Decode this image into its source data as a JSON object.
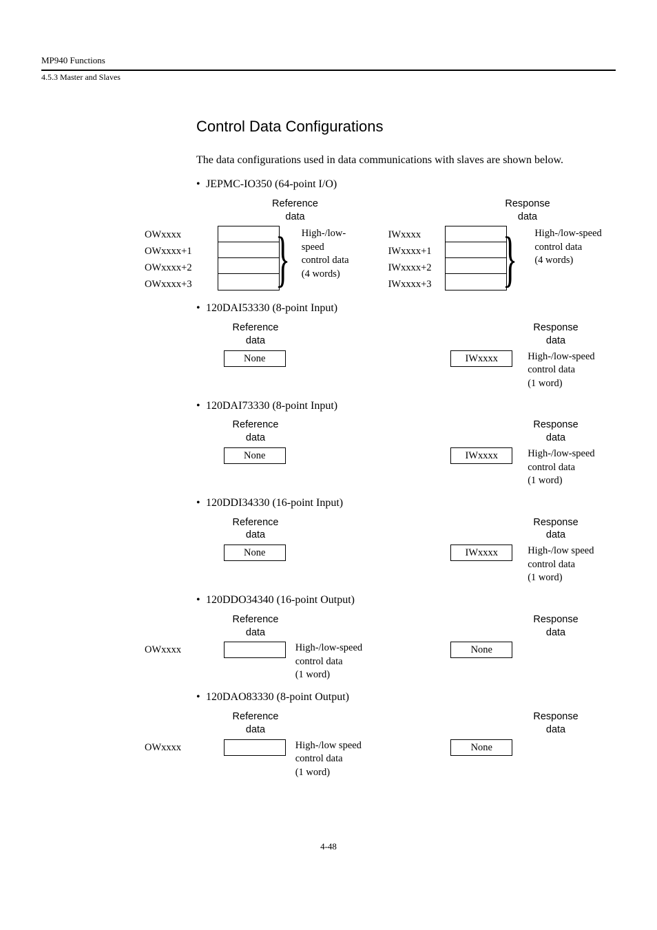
{
  "header": {
    "title": "MP940 Functions",
    "sub": "4.5.3  Master and Slaves"
  },
  "section": {
    "title": "Control Data Configurations",
    "intro": "The data configurations used in data communications with slaves are shown below."
  },
  "bullets": {
    "b1": "JEPMC-IO350 (64-point I/O)",
    "b2": "120DAI53330 (8-point Input)",
    "b3": "120DAI73330 (8-point Input)",
    "b4": "120DDI34330 (16-point Input)",
    "b5": "120DDO34340 (16-point Output)",
    "b6": "120DAO83330 (8-point Output)"
  },
  "labels": {
    "ref": "Reference",
    "resp": "Response",
    "data": "data",
    "none": "None",
    "ow0": "OWxxxx",
    "ow1": "OWxxxx+1",
    "ow2": "OWxxxx+2",
    "ow3": "OWxxxx+3",
    "iw0": "IWxxxx",
    "iw1": "IWxxxx+1",
    "iw2": "IWxxxx+2",
    "iw3": "IWxxxx+3"
  },
  "notes": {
    "hl4_a": "High-/low-",
    "hl4_b": "speed",
    "hl4_c": "control data",
    "hl4_d": "(4 words)",
    "hls4_a": "High-/low-speed",
    "hls4_b": "control data",
    "hls4_c": "(4 words)",
    "hls1_a": "High-/low-speed",
    "hls1_b": "control data",
    "hls1_c": "(1 word)",
    "hlsp1_a": "High-/low speed",
    "hlsp1_b": "control data",
    "hlsp1_c": "(1 word)"
  },
  "footer": "4-48"
}
